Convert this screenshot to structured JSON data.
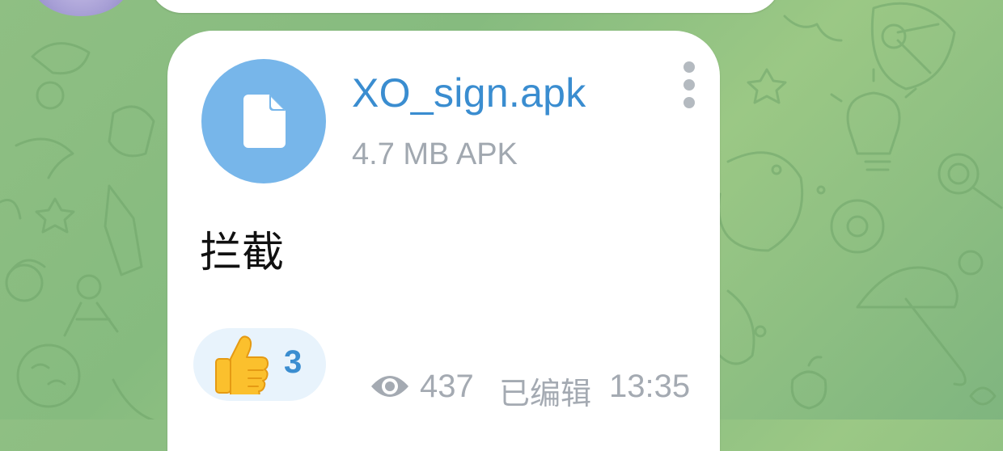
{
  "message": {
    "file_name": "XO_sign.apk",
    "file_meta": "4.7 MB APK",
    "caption": "拦截",
    "reaction": {
      "emoji": "thumbs-up-emoji",
      "count": "3"
    },
    "views": "437",
    "edited_label": "已编辑",
    "time": "13:35"
  },
  "icons": {
    "file": "file-icon",
    "menu": "more-vertical-icon",
    "views": "eye-icon"
  },
  "colors": {
    "link_blue": "#3a8dd0",
    "file_icon_bg": "#77b6ea",
    "meta_gray": "#a4aab2",
    "reaction_bg": "#e8f3fc",
    "wallpaper_green": "#8fbf83"
  }
}
